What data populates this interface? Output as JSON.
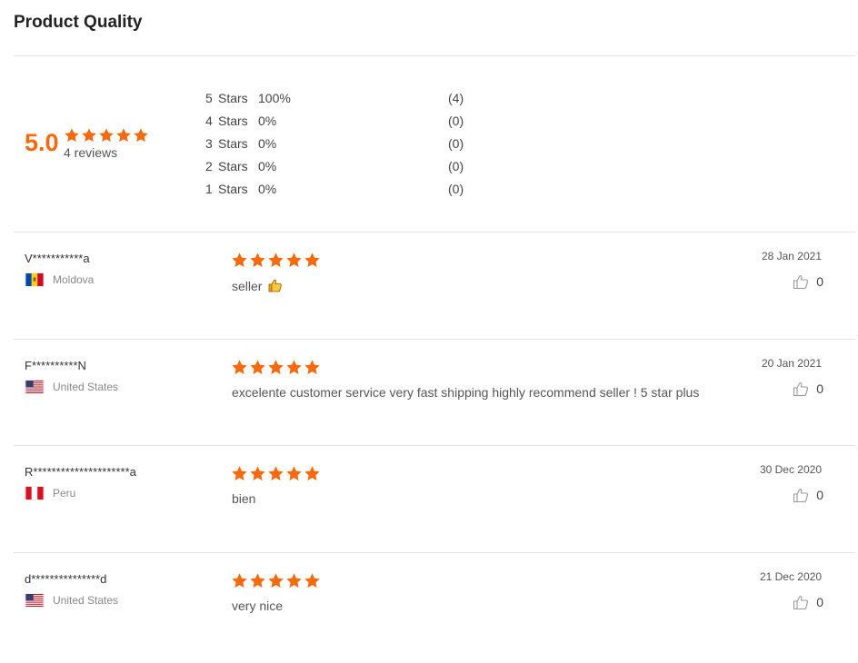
{
  "header": {
    "title": "Product Quality"
  },
  "summary": {
    "score": "5.0",
    "rating_stars": 5,
    "review_count_label": "4 reviews",
    "breakdown": [
      {
        "stars": "5",
        "label": "Stars",
        "percent": "100%",
        "count": "(4)"
      },
      {
        "stars": "4",
        "label": "Stars",
        "percent": "0%",
        "count": "(0)"
      },
      {
        "stars": "3",
        "label": "Stars",
        "percent": "0%",
        "count": "(0)"
      },
      {
        "stars": "2",
        "label": "Stars",
        "percent": "0%",
        "count": "(0)"
      },
      {
        "stars": "1",
        "label": "Stars",
        "percent": "0%",
        "count": "(0)"
      }
    ]
  },
  "reviews": [
    {
      "name": "V***********a",
      "country": "Moldova",
      "flag_icon": "moldova-flag-icon",
      "rating": 5,
      "text": "seller",
      "has_thumb_emoji": true,
      "date": "28 Jan 2021",
      "likes": "0"
    },
    {
      "name": "F**********N",
      "country": "United States",
      "flag_icon": "us-flag-icon",
      "rating": 5,
      "text": "excelente customer service very fast shipping highly recommend seller ! 5 star plus",
      "has_thumb_emoji": false,
      "date": "20 Jan 2021",
      "likes": "0"
    },
    {
      "name": "R*********************a",
      "country": "Peru",
      "flag_icon": "peru-flag-icon",
      "rating": 5,
      "text": "bien",
      "has_thumb_emoji": false,
      "date": "30 Dec 2020",
      "likes": "0"
    },
    {
      "name": "d***************d",
      "country": "United States",
      "flag_icon": "us-flag-icon",
      "rating": 5,
      "text": "very nice",
      "has_thumb_emoji": false,
      "date": "21 Dec 2020",
      "likes": "0"
    }
  ],
  "colors": {
    "accent": "#f56a0f",
    "divider": "#e3e3e3"
  }
}
